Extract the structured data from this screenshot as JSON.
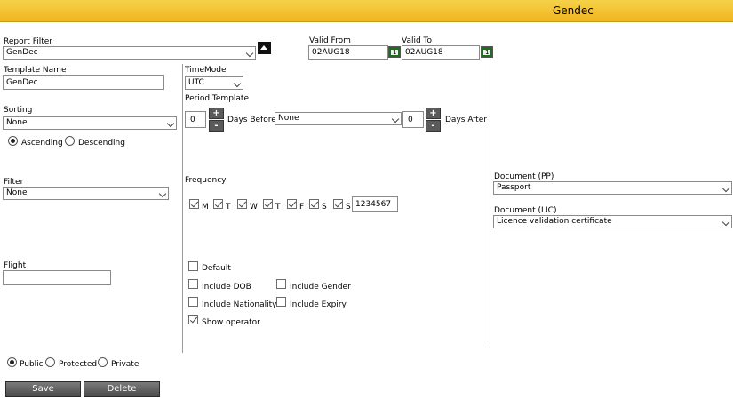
{
  "window": {
    "title": "Gendec"
  },
  "report_filter": {
    "label": "Report Filter",
    "value": "GenDec"
  },
  "valid_from": {
    "label": "Valid From",
    "value": "02AUG18",
    "cal_glyph": "1"
  },
  "valid_to": {
    "label": "Valid To",
    "value": "02AUG18",
    "cal_glyph": "1"
  },
  "template_name": {
    "label": "Template Name",
    "value": "GenDec"
  },
  "timemode": {
    "label": "TimeMode",
    "value": "UTC"
  },
  "period_template": {
    "label": "Period Template",
    "days_before_value": "0",
    "days_before_label": "Days Before",
    "select_value": "None",
    "days_after_value": "0",
    "days_after_label": "Days After",
    "plus": "+",
    "minus": "-"
  },
  "sorting": {
    "label": "Sorting",
    "value": "None",
    "ascending": "Ascending",
    "descending": "Descending"
  },
  "filter": {
    "label": "Filter",
    "value": "None"
  },
  "frequency": {
    "label": "Frequency",
    "days": [
      "M",
      "T",
      "W",
      "T",
      "F",
      "S",
      "S"
    ],
    "value": "1234567"
  },
  "document_pp": {
    "label": "Document (PP)",
    "value": "Passport"
  },
  "document_lic": {
    "label": "Document (LIC)",
    "value": "Licence validation certificate"
  },
  "flight": {
    "label": "Flight",
    "value": ""
  },
  "options": {
    "default": "Default",
    "include_dob": "Include DOB",
    "include_gender": "Include Gender",
    "include_nationality": "Include Nationality",
    "include_expiry": "Include Expiry",
    "show_operator": "Show operator"
  },
  "visibility": {
    "public": "Public",
    "protected": "Protected",
    "private": "Private"
  },
  "actions": {
    "save": "Save",
    "delete": "Delete"
  }
}
